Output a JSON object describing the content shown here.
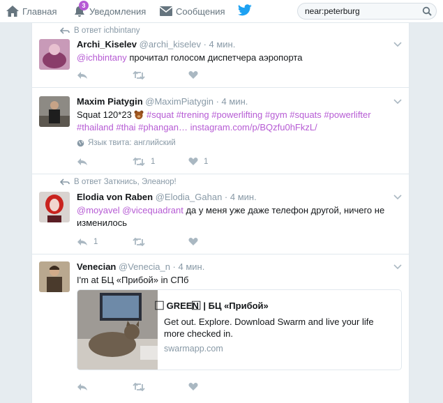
{
  "nav": {
    "home_label": "Главная",
    "notifications_label": "Уведомления",
    "notifications_badge": "3",
    "messages_label": "Сообщения"
  },
  "search": {
    "value": "near:peterburg"
  },
  "colors": {
    "accent": "#b65bd4",
    "muted": "#8899a6"
  },
  "tweets": [
    {
      "context": "В ответ ichbintany",
      "fullname": "Archi_Kiselev",
      "meta": "@archi_kiselev · 4 мин.",
      "mention": "@ichbintany",
      "text": " прочитал голосом диспетчера аэропорта"
    },
    {
      "fullname": "Maxim Piatygin",
      "meta": "@MaximPiatygin · 4 мин.",
      "text_start": "Squat 120*23 ",
      "hashtags": "#squat #trening #powerlifting #gym #squats #powerlifter #thailand #thai #phangan… instagram.com/p/BQzfu0hFkzL/",
      "lang": "Язык твита: английский",
      "retweets": "1",
      "likes": "1"
    },
    {
      "context": "В ответ Заткнись, Элеанор!",
      "fullname": "Elodia von Raben",
      "meta": "@Elodia_Gahan · 4 мин.",
      "mentions": "@moyavel @vicequadrant",
      "text": " да у меня уже даже телефон другой, ничего не изменилось",
      "replies": "1"
    },
    {
      "fullname": "Venecian",
      "meta": "@Venecia_n · 4 мин.",
      "text": "I'm at БЦ «Прибой» in СПб",
      "card": {
        "title": "⃞ GREEN ⃞ | БЦ «Прибой»",
        "desc": "Get out. Explore. Download Swarm and live your life more checked in.",
        "url": "swarmapp.com"
      }
    }
  ]
}
